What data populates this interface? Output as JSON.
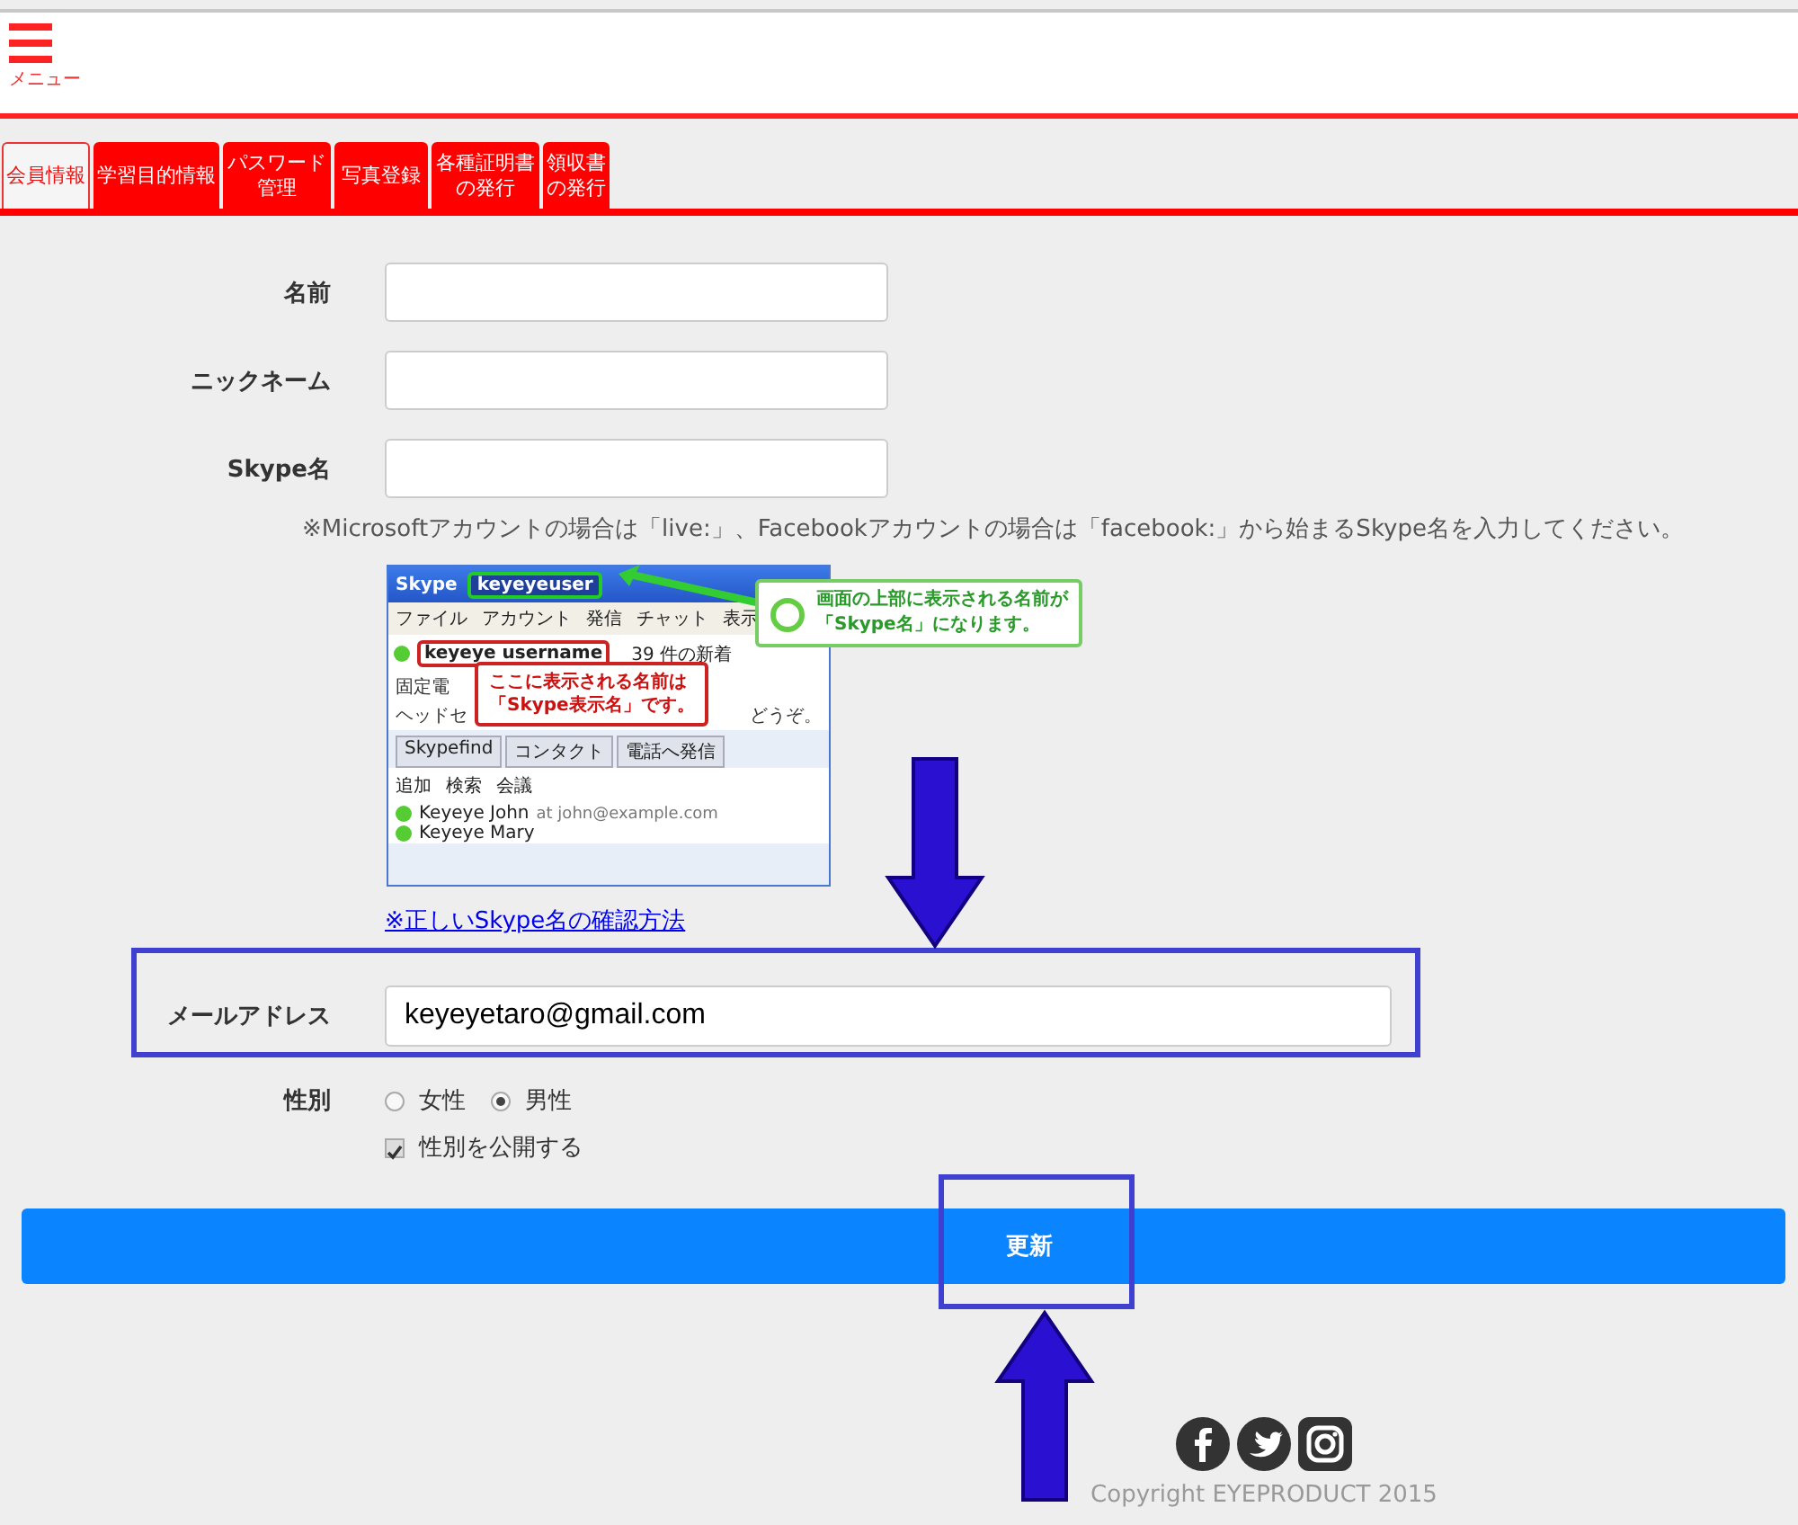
{
  "header": {
    "menu_label": "メニュー"
  },
  "tabs": [
    {
      "lines": [
        "会員情報"
      ],
      "selected": true
    },
    {
      "lines": [
        "学習目的情報"
      ],
      "selected": false
    },
    {
      "lines": [
        "パスワード",
        "管理"
      ],
      "selected": false
    },
    {
      "lines": [
        "写真登録"
      ],
      "selected": false
    },
    {
      "lines": [
        "各種証明書",
        "の発行"
      ],
      "selected": false
    },
    {
      "lines": [
        "領収書",
        "の発行"
      ],
      "selected": false
    }
  ],
  "fields": [
    {
      "label": "名前"
    },
    {
      "label": "ニックネーム"
    },
    {
      "label": "Skype名"
    }
  ],
  "skype_note": "※Microsoftアカウントの場合は「live:」、Facebookアカウントの場合は「facebook:」から始まるSkype名を入力してください。",
  "skype_window": {
    "title": "Skype",
    "username": "keyeyeuser",
    "menu": [
      "ファイル",
      "アカウント",
      "発信",
      "チャット",
      "表示"
    ],
    "display_name": "keyeye username",
    "news": "39 件の新着",
    "info_lines": [
      "固定電",
      "ヘッドセ"
    ],
    "info_tail": "どうぞ。",
    "tabs": [
      "Skypefind",
      "コンタクト",
      "電話へ発信"
    ],
    "tools": [
      "追加",
      "検索",
      "会議"
    ],
    "contacts": [
      {
        "name": "Keyeye John",
        "detail": "at john@example.com"
      },
      {
        "name": "Keyeye Mary"
      }
    ],
    "callout_top": [
      "画面の上部に表示される名前が",
      "「Skype名」になります。"
    ],
    "callout_name": [
      "ここに表示される名前は",
      "「Skype表示名」です。"
    ]
  },
  "help_link": "※正しいSkype名の確認方法",
  "email": {
    "label": "メールアドレス",
    "value": "keyeyetaro@gmail.com"
  },
  "gender": {
    "label": "性別",
    "options": [
      {
        "label": "女性",
        "selected": false
      },
      {
        "label": "男性",
        "selected": true
      }
    ],
    "publish": {
      "label": "性別を公開する",
      "checked": true
    }
  },
  "submit": "更新",
  "footer": {
    "copyright": "Copyright EYEPRODUCT 2015"
  }
}
